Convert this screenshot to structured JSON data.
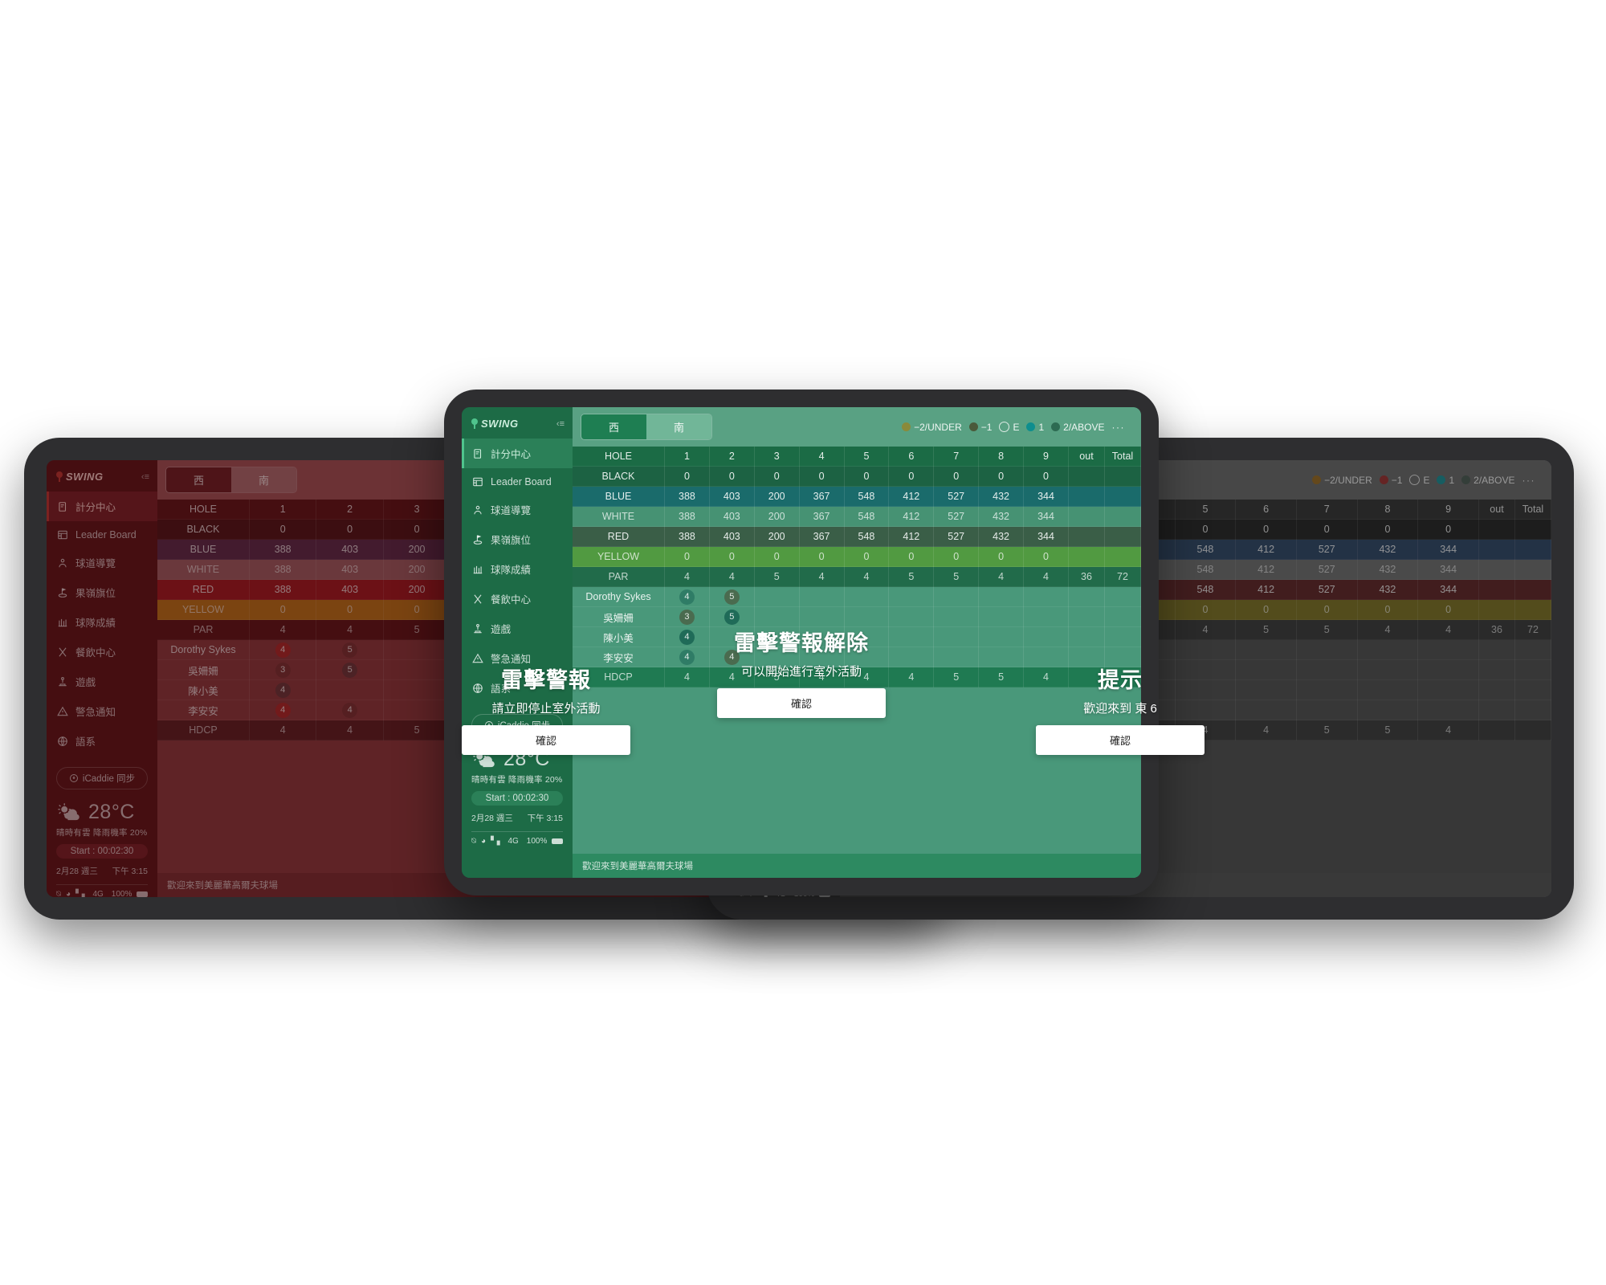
{
  "app": {
    "brand": "SWING",
    "collapse_icon": "collapse-menu-icon",
    "nav": [
      {
        "label": "計分中心",
        "icon": "scorecard-icon",
        "active": true
      },
      {
        "label": "Leader Board",
        "icon": "leaderboard-icon",
        "active": false
      },
      {
        "label": "球道導覽",
        "icon": "fairway-guide-icon",
        "active": false
      },
      {
        "label": "果嶺旗位",
        "icon": "green-pin-icon",
        "active": false
      },
      {
        "label": "球隊成績",
        "icon": "team-score-icon",
        "active": false
      },
      {
        "label": "餐飲中心",
        "icon": "dining-icon",
        "active": false
      },
      {
        "label": "遊戲",
        "icon": "game-icon",
        "active": false
      },
      {
        "label": "警急通知",
        "icon": "alert-icon",
        "active": false
      },
      {
        "label": "語系",
        "icon": "globe-icon",
        "active": false
      }
    ],
    "sync_button": "iCaddie 同步",
    "weather": {
      "temperature": "28",
      "unit": "°C",
      "description": "晴時有雲  降雨機率 20%",
      "icon": "sun-cloud-icon"
    },
    "start_timer": "Start : 00:02:30",
    "date": "2月28 週三",
    "time": "下午 3:15",
    "status": {
      "network": "4G",
      "battery": "100%",
      "wifi_icon": "wifi-icon",
      "signal_icon": "signal-bars-icon",
      "compass_icon": "compass-icon"
    },
    "tabs": [
      {
        "label": "西",
        "active": true
      },
      {
        "label": "南",
        "active": false
      }
    ],
    "legend": [
      {
        "label": "−2/UNDER",
        "color": "#8a8a3a",
        "style": "solid"
      },
      {
        "label": "−1",
        "color": "#4a5a3a",
        "style": "solid"
      },
      {
        "label": "E",
        "color": "transparent",
        "style": "hollow"
      },
      {
        "label": "1",
        "color": "#0e8e8e",
        "style": "solid"
      },
      {
        "label": "2/ABOVE",
        "color": "#2d6b52",
        "style": "solid"
      }
    ],
    "legend_more": "···",
    "bottom_message": "歡迎來到美麗華高爾夫球場"
  },
  "scorecard": {
    "columns": [
      "HOLE",
      "1",
      "2",
      "3",
      "4",
      "5",
      "6",
      "7",
      "8",
      "9",
      "out",
      "Total"
    ],
    "rows": [
      {
        "label": "BLACK",
        "type": "tee",
        "values": [
          "0",
          "0",
          "0",
          "0",
          "0",
          "0",
          "0",
          "0",
          "0",
          "",
          ""
        ]
      },
      {
        "label": "BLUE",
        "type": "tee",
        "values": [
          "388",
          "403",
          "200",
          "367",
          "548",
          "412",
          "527",
          "432",
          "344",
          "",
          ""
        ]
      },
      {
        "label": "WHITE",
        "type": "tee",
        "values": [
          "388",
          "403",
          "200",
          "367",
          "548",
          "412",
          "527",
          "432",
          "344",
          "",
          ""
        ]
      },
      {
        "label": "RED",
        "type": "tee",
        "values": [
          "388",
          "403",
          "200",
          "367",
          "548",
          "412",
          "527",
          "432",
          "344",
          "",
          ""
        ]
      },
      {
        "label": "YELLOW",
        "type": "tee",
        "values": [
          "0",
          "0",
          "0",
          "0",
          "0",
          "0",
          "0",
          "0",
          "0",
          "",
          ""
        ]
      },
      {
        "label": "PAR",
        "type": "par",
        "values": [
          "4",
          "4",
          "5",
          "4",
          "4",
          "5",
          "5",
          "4",
          "4",
          "36",
          "72"
        ]
      },
      {
        "label": "Dorothy Sykes",
        "type": "player",
        "values": [
          "4",
          "5",
          "",
          "",
          "",
          "",
          "",
          "",
          "",
          "",
          ""
        ]
      },
      {
        "label": "吳姍姍",
        "type": "player",
        "values": [
          "3",
          "5",
          "",
          "",
          "",
          "",
          "",
          "",
          "",
          "",
          ""
        ]
      },
      {
        "label": "陳小美",
        "type": "player",
        "values": [
          "4",
          "",
          "",
          "",
          "",
          "",
          "",
          "",
          "",
          "",
          ""
        ]
      },
      {
        "label": "李安安",
        "type": "player",
        "values": [
          "4",
          "4",
          "",
          "",
          "",
          "",
          "",
          "",
          "",
          "",
          ""
        ]
      },
      {
        "label": "HDCP",
        "type": "hdcp",
        "values": [
          "4",
          "4",
          "5",
          "4",
          "4",
          "4",
          "5",
          "5",
          "4",
          "",
          ""
        ]
      }
    ]
  },
  "dialogs": {
    "left": {
      "title": "雷擊警報",
      "body": "請立即停止室外活動",
      "confirm": "確認"
    },
    "center": {
      "title": "雷擊警報解除",
      "body": "可以開始進行室外活動",
      "confirm": "確認"
    },
    "right": {
      "title": "提示",
      "body": "歡迎來到 東 6",
      "confirm": "確認"
    }
  },
  "themes": {
    "left": {
      "name": "alert-red",
      "accent": "#8d1b22"
    },
    "center": {
      "name": "safe-green",
      "accent": "#14663f"
    },
    "right": {
      "name": "neutral-gray",
      "accent": "#4a4a4a"
    }
  }
}
